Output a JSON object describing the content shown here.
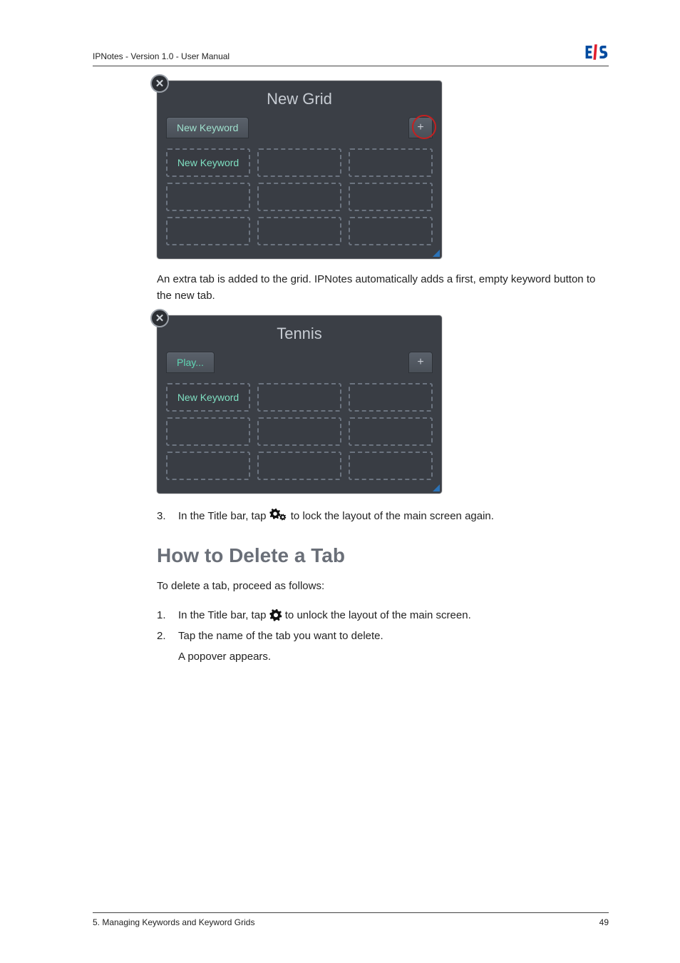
{
  "header": {
    "doc_title": "IPNotes - Version 1.0 - User Manual"
  },
  "figure1": {
    "close_label": "✕",
    "title": "New Grid",
    "tab1": "New Keyword",
    "add_label": "+",
    "first_cell": "New Keyword"
  },
  "paragraph1": "An extra tab is added to the grid. IPNotes automatically adds a first, empty keyword button to the new tab.",
  "figure2": {
    "close_label": "✕",
    "title": "Tennis",
    "tab1": "Play...",
    "add_label": "+",
    "first_cell": "New Keyword"
  },
  "step3": {
    "num": "3.",
    "before": "In the Title bar, tap ",
    "after": " to lock the layout of the main screen again."
  },
  "section_heading": "How to Delete a Tab",
  "intro": "To delete a tab, proceed as follows:",
  "steps": {
    "s1": {
      "num": "1.",
      "before": "In the Title bar, tap ",
      "after": " to unlock the layout of the main screen."
    },
    "s2": {
      "num": "2.",
      "text": "Tap the name of the tab you want to delete."
    },
    "s2_sub": "A popover appears."
  },
  "footer": {
    "left": "5. Managing Keywords and Keyword Grids",
    "right": "49"
  }
}
